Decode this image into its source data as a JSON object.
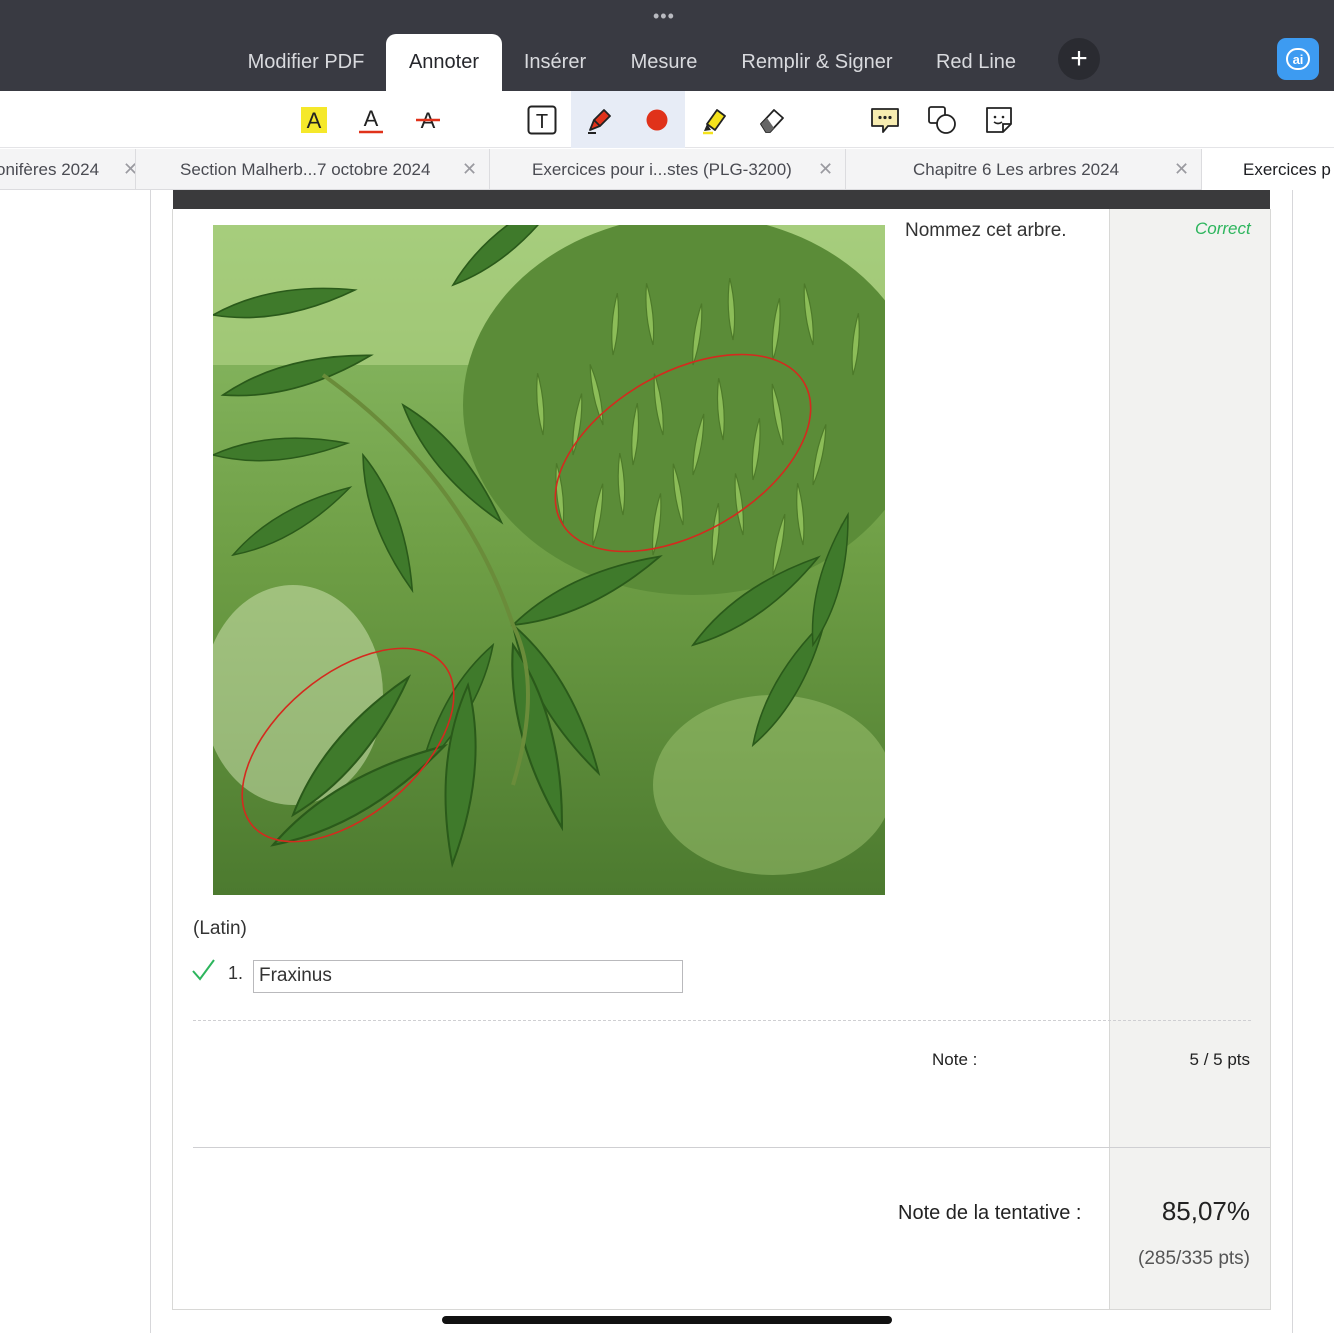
{
  "topbar": {
    "tabs": [
      {
        "label": "Modifier PDF"
      },
      {
        "label": "Annoter"
      },
      {
        "label": "Insérer"
      },
      {
        "label": "Mesure"
      },
      {
        "label": "Remplir & Signer"
      },
      {
        "label": "Red Line"
      }
    ],
    "active_tab": "Annoter",
    "plus_label": "+",
    "ai_label": "ai"
  },
  "toolbar": {
    "highlight_text_letter": "A",
    "underline_text_letter": "A",
    "strikethrough_text_letter": "A",
    "textbox_letter": "T",
    "selected_tool": "pen",
    "pen_color": "#e0321a",
    "highlighter_color": "#f4e21d",
    "icons": [
      "highlight-text-icon",
      "underline-text-icon",
      "strikethrough-text-icon",
      "textbox-icon",
      "pen-icon",
      "color-dot-icon",
      "highlighter-icon",
      "eraser-icon",
      "comment-icon",
      "shapes-icon",
      "sticker-icon"
    ]
  },
  "doc_tabs": [
    {
      "label": "onifères 2024"
    },
    {
      "label": "Section Malherb...7 octobre 2024"
    },
    {
      "label": "Exercices pour i...stes (PLG-3200)"
    },
    {
      "label": "Chapitre 6 Les arbres  2024"
    },
    {
      "label": "Exercices p"
    }
  ],
  "question": {
    "prompt": "Nommez cet arbre.",
    "status": "Correct",
    "hint": "(Latin)",
    "item_number": "1.",
    "answer": "Fraxinus",
    "note_label": "Note :",
    "note_value": "5 / 5 pts"
  },
  "attempt": {
    "label": "Note de la tentative :",
    "percent": "85,07%",
    "points": "(285/335 pts)"
  },
  "colors": {
    "topbar": "#393a42",
    "correct": "#2db55d",
    "annotation": "#d42a1e",
    "ai_button": "#3d9bf1"
  }
}
